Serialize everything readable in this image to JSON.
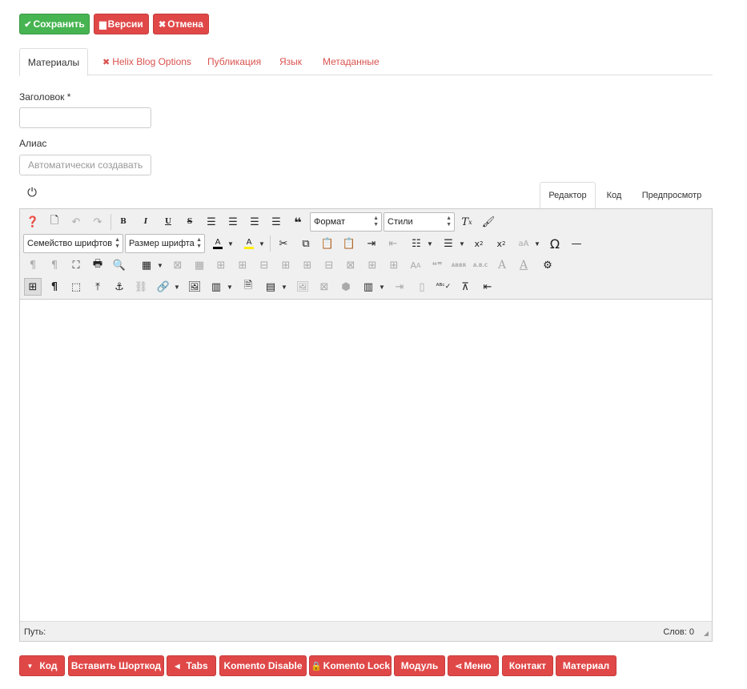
{
  "top_buttons": {
    "save": "Сохранить",
    "versions": "Версии",
    "cancel": "Отмена"
  },
  "tabs": [
    "Материалы",
    "Helix Blog Options",
    "Публикация",
    "Язык",
    "Метаданные"
  ],
  "form": {
    "title_label": "Заголовок *",
    "title_value": "",
    "alias_label": "Алиас",
    "alias_placeholder": "Автоматически создавать и"
  },
  "editor_tabs": [
    "Редактор",
    "Код",
    "Предпросмотр"
  ],
  "toolbar": {
    "format_select": "Формат",
    "styles_select": "Стили",
    "font_family_select": "Семейство шрифтов",
    "font_size_select": "Размер шрифта"
  },
  "status": {
    "path_label": "Путь:",
    "word_count": "Слов: 0"
  },
  "bottom_buttons": [
    "Код",
    "Вставить Шорткод",
    "Tabs",
    "Komento Disable",
    "Komento Lock",
    "Модуль",
    "Меню",
    "Контакт",
    "Материал"
  ],
  "colors": {
    "green": "#46b450",
    "red": "#e04848",
    "tab_link": "#d9534f"
  }
}
